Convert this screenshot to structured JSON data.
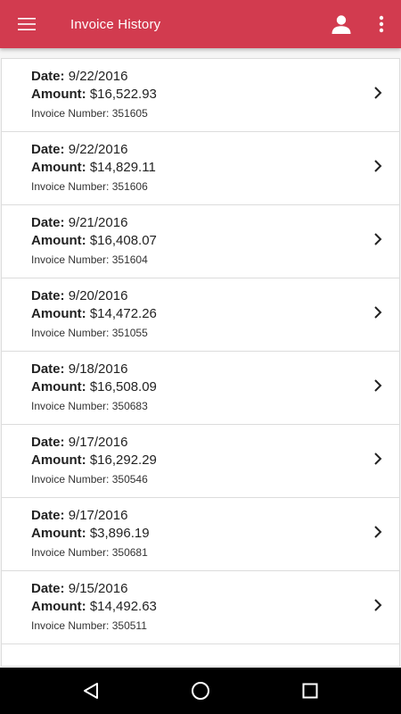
{
  "colors": {
    "appbar": "#d23b4f",
    "navbar": "#000000",
    "text": "#222222"
  },
  "appbar": {
    "title": "Invoice History",
    "menu_icon": "hamburger-menu-icon",
    "account_icon": "account-icon",
    "more_icon": "more-vert-icon"
  },
  "labels": {
    "date": "Date:",
    "amount": "Amount:",
    "invoice_number": "Invoice Number:"
  },
  "invoices": [
    {
      "date": "9/22/2016",
      "amount": "$16,522.93",
      "number": "351605"
    },
    {
      "date": "9/22/2016",
      "amount": "$14,829.11",
      "number": "351606"
    },
    {
      "date": "9/21/2016",
      "amount": "$16,408.07",
      "number": "351604"
    },
    {
      "date": "9/20/2016",
      "amount": "$14,472.26",
      "number": "351055"
    },
    {
      "date": "9/18/2016",
      "amount": "$16,508.09",
      "number": "350683"
    },
    {
      "date": "9/17/2016",
      "amount": "$16,292.29",
      "number": "350546"
    },
    {
      "date": "9/17/2016",
      "amount": "$3,896.19",
      "number": "350681"
    },
    {
      "date": "9/15/2016",
      "amount": "$14,492.63",
      "number": "350511"
    }
  ],
  "navbar": {
    "back_icon": "back-triangle-icon",
    "home_icon": "home-circle-icon",
    "recents_icon": "recents-square-icon"
  }
}
